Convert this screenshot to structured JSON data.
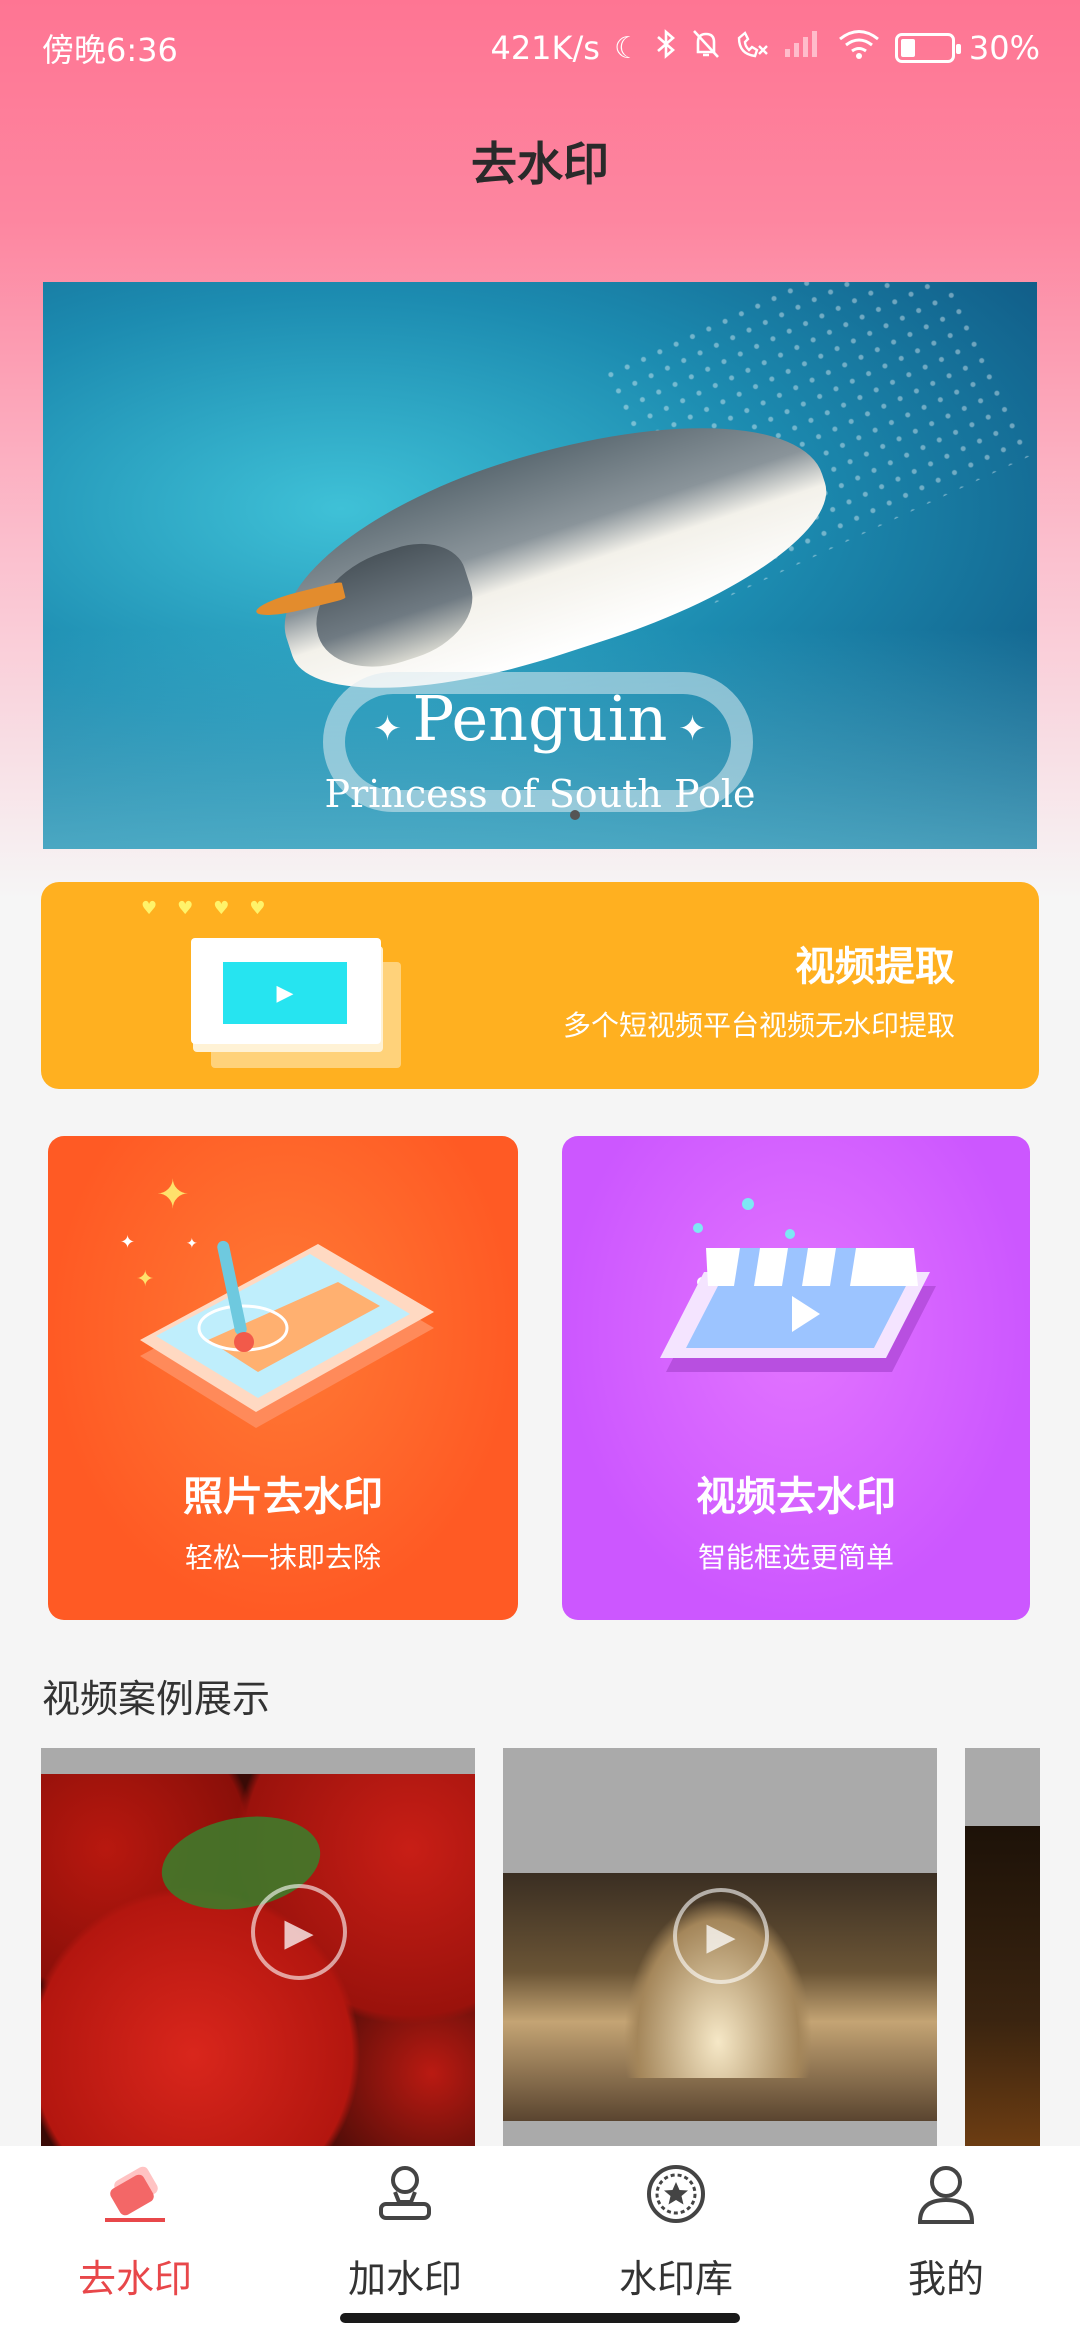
{
  "status_bar": {
    "time": "傍晚6:36",
    "network_speed": "421K/s",
    "battery": "30%",
    "battery_level": 0.3,
    "icons": [
      "moon-icon",
      "bluetooth-icon",
      "mute-bell-icon",
      "missed-call-icon",
      "signal-icon",
      "wifi-icon",
      "battery-icon"
    ]
  },
  "header": {
    "title": "去水印"
  },
  "banner": {
    "title": "Penguin",
    "subtitle": "Princess of South Pole"
  },
  "extract_card": {
    "title": "视频提取",
    "description": "多个短视频平台视频无水印提取",
    "color": "#ffb020"
  },
  "features": [
    {
      "title": "照片去水印",
      "subtitle": "轻松一抹即去除",
      "color": "#ff5a24"
    },
    {
      "title": "视频去水印",
      "subtitle": "智能框选更简单",
      "color": "#cc57ff"
    }
  ],
  "cases_section": {
    "title": "视频案例展示"
  },
  "bottom_nav": {
    "items": [
      {
        "label": "去水印",
        "icon": "eraser-icon",
        "active": true
      },
      {
        "label": "加水印",
        "icon": "stamp-icon",
        "active": false
      },
      {
        "label": "水印库",
        "icon": "star-badge-icon",
        "active": false
      },
      {
        "label": "我的",
        "icon": "user-icon",
        "active": false
      }
    ],
    "active_color": "#e8474a"
  }
}
